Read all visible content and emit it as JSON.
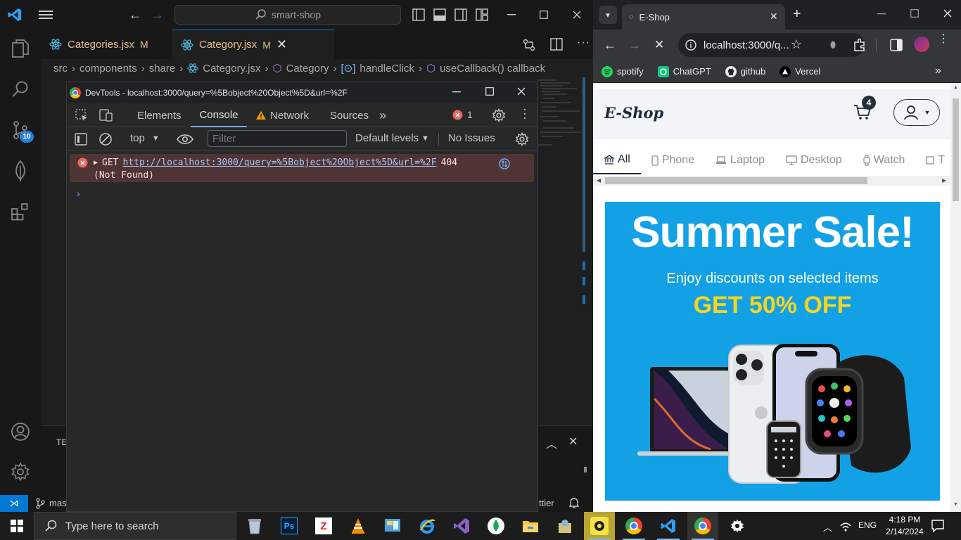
{
  "vscode": {
    "search_text": "smart-shop",
    "tabs": [
      {
        "label": "Categories.jsx",
        "badge": "M"
      },
      {
        "label": "Category.jsx",
        "badge": "M"
      }
    ],
    "breadcrumb": [
      "src",
      "components",
      "share",
      "Category.jsx",
      "Category",
      "handleClick",
      "useCallback() callback"
    ],
    "source_badge": "10",
    "status_branch": "mas",
    "status_right": "ttier",
    "panel_tab": "TE"
  },
  "devtools": {
    "title": "DevTools - localhost:3000/query=%5Bobject%20Object%5D&url=%2F",
    "tabs": [
      "Elements",
      "Console",
      "Network",
      "Sources"
    ],
    "error_count": "1",
    "context": "top",
    "filter_placeholder": "Filter",
    "levels": "Default levels",
    "issues": "No Issues",
    "error": {
      "method": "GET",
      "url": "http://localhost:3000/query=%5Bobject%20Object%5D&url=%2F",
      "status": "404",
      "status_text": "(Not Found)"
    }
  },
  "chrome": {
    "tab_title": "E-Shop",
    "omnibox_url": "localhost:3000/q...",
    "bookmarks": [
      "spotify",
      "ChatGPT",
      "github",
      "Vercel"
    ]
  },
  "eshop": {
    "logo": "E-Shop",
    "cart_count": "4",
    "categories": [
      "All",
      "Phone",
      "Laptop",
      "Desktop",
      "Watch",
      "T"
    ],
    "banner": {
      "title": "Summer Sale!",
      "subtitle": "Enjoy discounts on selected items",
      "offer": "GET 50% OFF"
    }
  },
  "taskbar": {
    "search_placeholder": "Type here to search",
    "language": "ENG",
    "time": "4:18 PM",
    "date": "2/14/2024"
  },
  "colors": {
    "banner_bg": "#13a1e5",
    "offer_text": "#fbd51c",
    "error_bg": "#4e3534",
    "console_tab_underline": "#7cacf8"
  }
}
